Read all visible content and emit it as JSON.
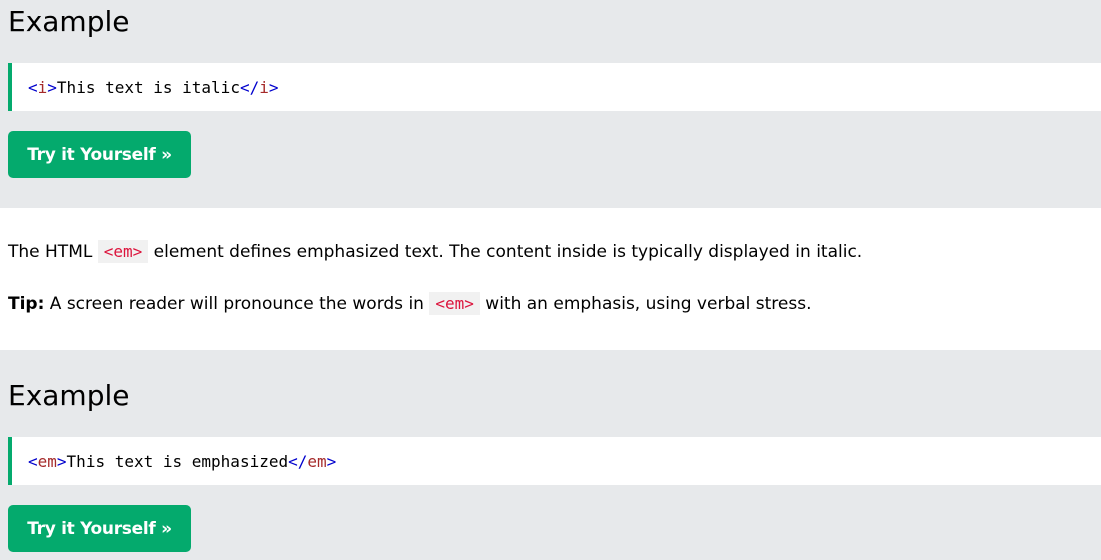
{
  "example1": {
    "heading": "Example",
    "code": {
      "open_lt": "<",
      "open_tag": "i",
      "open_gt": ">",
      "content": "This text is italic",
      "close_lt": "</",
      "close_tag": "i",
      "close_gt": ">"
    },
    "button_label": "Try it Yourself »"
  },
  "description": {
    "p1_before": "The HTML ",
    "p1_code": "<em>",
    "p1_after": " element defines emphasized text. The content inside is typically displayed in italic.",
    "tip_label": "Tip:",
    "p2_before": " A screen reader will pronounce the words in ",
    "p2_code": "<em>",
    "p2_after": " with an emphasis, using verbal stress."
  },
  "example2": {
    "heading": "Example",
    "code": {
      "open_lt": "<",
      "open_tag": "em",
      "open_gt": ">",
      "content": "This text is emphasized",
      "close_lt": "</",
      "close_tag": "em",
      "close_gt": ">"
    },
    "button_label": "Try it Yourself »"
  },
  "colors": {
    "accent_green": "#04aa6d",
    "panel_gray": "#e7e9eb",
    "tag_bracket_blue": "#0000cd",
    "tag_name_brown": "#a52a2a",
    "inline_code_red": "#dc143c"
  }
}
